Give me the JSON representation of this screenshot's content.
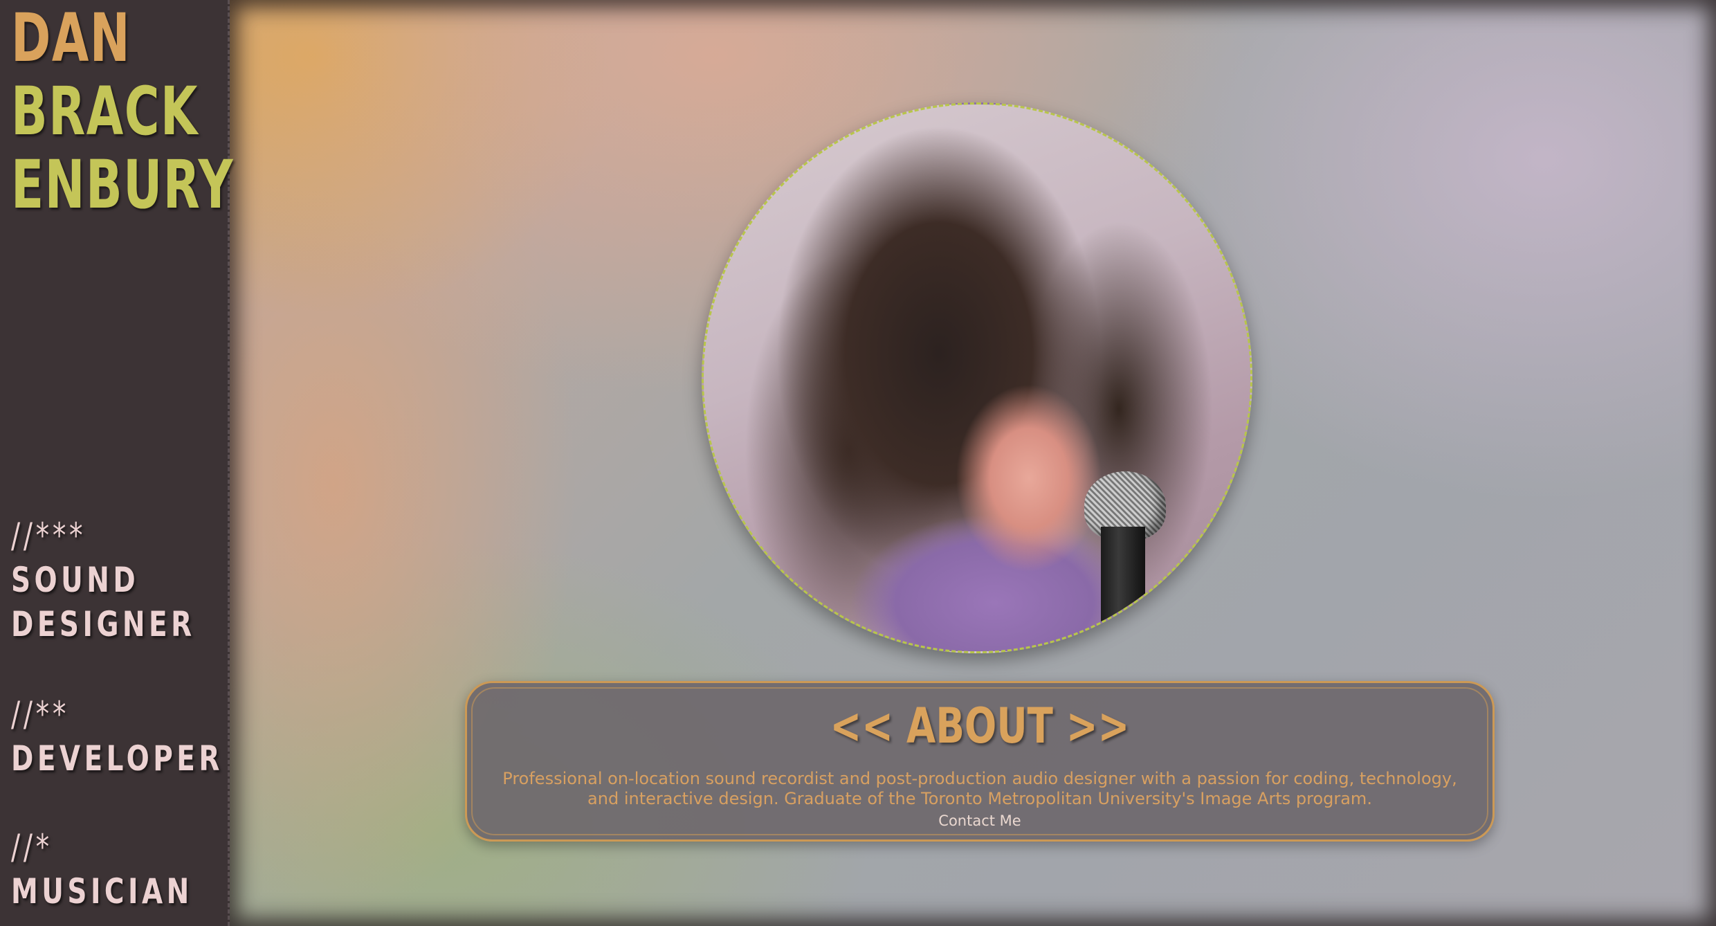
{
  "sidebar": {
    "name_lines": [
      "DAN",
      "BRACK",
      "ENBURY"
    ],
    "roles": [
      {
        "stars": "//***",
        "label_lines": [
          "SOUND",
          "DESIGNER"
        ]
      },
      {
        "stars": "//**",
        "label_lines": [
          "DEVELOPER"
        ]
      },
      {
        "stars": "//*",
        "label_lines": [
          "MUSICIAN"
        ]
      }
    ]
  },
  "about": {
    "title": "<< ABOUT >>",
    "text": "Professional on-location sound recordist and post-production audio designer with a passion for coding, technology, and interactive design. Graduate of the Toronto Metropolitan University's Image Arts program.",
    "contact_label": "Contact Me"
  },
  "colors": {
    "sidebar_bg": "#3c3335",
    "name_orange": "#d9a25c",
    "name_green": "#c4c558",
    "role_text": "#ecd2d2",
    "about_accent": "#cc9955",
    "portrait_border": "#b8c64a"
  }
}
